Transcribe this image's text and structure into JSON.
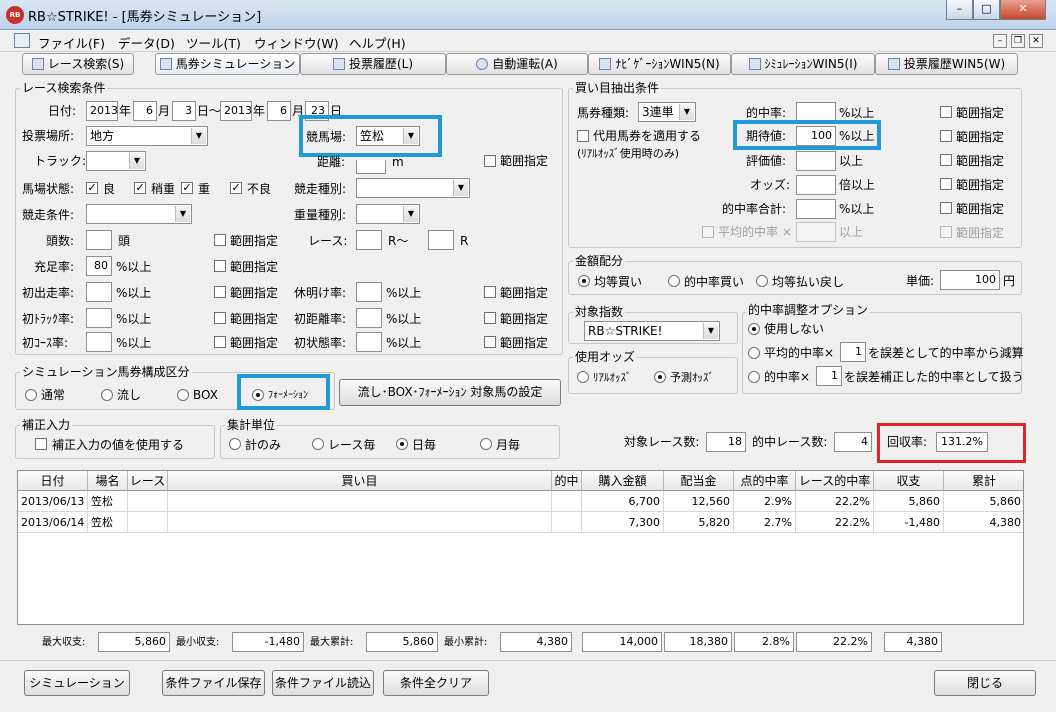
{
  "window": {
    "title": "RB☆STRIKE! - [馬券シミュレーション]",
    "icon": "app-logo-icon",
    "buttons": [
      "–",
      "□",
      "✕"
    ]
  },
  "menubar": {
    "items": [
      "ファイル(F)",
      "データ(D)",
      "ツール(T)",
      "ウィンドウ(W)",
      "ヘルプ(H)"
    ],
    "mdi": [
      "–",
      "❐",
      "✕"
    ]
  },
  "tabs": [
    {
      "label": "レース検索(S)",
      "icon": "search-icon"
    },
    {
      "label": "馬券シミュレーション(B)",
      "icon": "simulation-icon"
    },
    {
      "label": "投票履歴(L)",
      "icon": "history-icon"
    },
    {
      "label": "自動運転(A)",
      "icon": "clock-icon"
    },
    {
      "label": "ﾅﾋﾞｹﾞｰｼｮﾝWIN5(N)",
      "icon": "navigation-icon"
    },
    {
      "label": "ｼﾐｭﾚｰｼｮﾝWIN5(I)",
      "icon": "simulation-win5-icon"
    },
    {
      "label": "投票履歴WIN5(W)",
      "icon": "history-win5-icon"
    }
  ],
  "search": {
    "group_title": "レース検索条件",
    "date_label": "日付:",
    "from_year": "2013",
    "year_unit": "年",
    "from_month": "6",
    "month_unit": "月",
    "from_day": "3",
    "day_unit": "日〜",
    "to_year": "2013",
    "to_month": "6",
    "to_day": "23",
    "day_unit2": "日",
    "venue_label": "投票場所:",
    "venue_value": "地方",
    "track_name_label": "競馬場:",
    "track_name_value": "笠松",
    "track_label": "トラック:",
    "track_value": "",
    "distance_label": "距離:",
    "distance_value": "",
    "distance_unit": "m",
    "distance_range": "範囲指定",
    "condition_label": "馬場状態:",
    "conditions": [
      "良",
      "稍重",
      "重",
      "不良"
    ],
    "race_type_label": "競走種別:",
    "race_type_value": "",
    "race_cond_label": "競走条件:",
    "race_cond_value": "",
    "weight_label": "重量種別:",
    "weight_value": "",
    "head_label": "頭数:",
    "head_value": "",
    "head_unit": "頭",
    "head_range": "範囲指定",
    "race_label": "レース:",
    "race_from": "",
    "race_from_unit": "R〜",
    "race_to": "",
    "race_to_unit": "R",
    "fill_label": "充足率:",
    "fill_value": "80",
    "fill_unit": "%以上",
    "fill_range": "範囲指定",
    "debut_label": "初出走率:",
    "debut_unit": "%以上",
    "debut_range": "範囲指定",
    "rest_label": "休明け率:",
    "rest_unit": "%以上",
    "rest_range": "範囲指定",
    "firsttrack_label": "初ﾄﾗｯｸ率:",
    "firsttrack_unit": "%以上",
    "firsttrack_range": "範囲指定",
    "firstdist_label": "初距離率:",
    "firstdist_unit": "%以上",
    "firstdist_range": "範囲指定",
    "firstcourse_label": "初ｺｰｽ率:",
    "firstcourse_unit": "%以上",
    "firstcourse_range": "範囲指定",
    "firststate_label": "初状態率:",
    "firststate_unit": "%以上",
    "firststate_range": "範囲指定"
  },
  "sim_comp": {
    "group_title": "シミュレーション馬券構成区分",
    "options": [
      "通常",
      "流し",
      "BOX",
      "ﾌｫｰﾒｰｼｮﾝ"
    ],
    "selected": 3,
    "set_button": "流し･BOX･ﾌｫｰﾒｰｼｮﾝ 対象馬の設定"
  },
  "correction": {
    "group_title": "補正入力",
    "checkbox": "補正入力の値を使用する"
  },
  "aggregate": {
    "group_title": "集計単位",
    "options": [
      "計のみ",
      "レース毎",
      "日毎",
      "月毎"
    ],
    "selected": 2
  },
  "extract": {
    "group_title": "買い目抽出条件",
    "ticket_label": "馬券種類:",
    "ticket_value": "3連単",
    "substitute_label": "代用馬券を適用する",
    "substitute_note": "(ﾘｱﾙｵｯｽﾞ使用時のみ)",
    "hit_label": "的中率:",
    "hit_value": "",
    "hit_unit": "%以上",
    "ev_label": "期待値:",
    "ev_value": "100",
    "ev_unit": "%以上",
    "eval_label": "評価値:",
    "eval_value": "",
    "eval_unit": "以上",
    "odds_label": "オッズ:",
    "odds_value": "",
    "odds_unit": "倍以上",
    "hitsum_label": "的中率合計:",
    "hitsum_value": "",
    "hitsum_unit": "%以上",
    "avg_label": "平均的中率 ×",
    "avg_value": "",
    "avg_unit": "以上",
    "range": "範囲指定"
  },
  "allocation": {
    "group_title": "金額配分",
    "options": [
      "均等買い",
      "的中率買い",
      "均等払い戻し"
    ],
    "selected": 0,
    "unit_label": "単価:",
    "unit_value": "100",
    "unit_suffix": "円"
  },
  "index": {
    "group_title": "対象指数",
    "value": "RB☆STRIKE!"
  },
  "odds_used": {
    "group_title": "使用オッズ",
    "options": [
      "ﾘｱﾙｵｯｽﾞ",
      "予測ｵｯｽﾞ"
    ],
    "selected": 1
  },
  "hit_adjust": {
    "group_title": "的中率調整オプション",
    "opt0": "使用しない",
    "opt1_pre": "平均的中率×",
    "opt1_val": "1",
    "opt1_post": "を誤差として的中率から減算",
    "opt2_pre": "的中率×",
    "opt2_val": "1",
    "opt2_post": "を誤差補正した的中率として扱う",
    "selected": 0
  },
  "summary": {
    "target_label": "対象レース数:",
    "target_value": "18",
    "hit_label": "的中レース数:",
    "hit_value": "4",
    "recovery_label": "回収率:",
    "recovery_value": "131.2%"
  },
  "table": {
    "headers": [
      "日付",
      "場名",
      "レース",
      "買い目",
      "的中",
      "購入金額",
      "配当金",
      "点的中率",
      "レース的中率",
      "収支",
      "累計"
    ],
    "rows": [
      [
        "2013/06/13",
        "笠松",
        "",
        "",
        "",
        "6,700",
        "12,560",
        "2.9%",
        "22.2%",
        "5,860",
        "5,860"
      ],
      [
        "2013/06/14",
        "笠松",
        "",
        "",
        "",
        "7,300",
        "5,820",
        "2.7%",
        "22.2%",
        "-1,480",
        "4,380"
      ]
    ]
  },
  "totals": {
    "max_income_label": "最大収支:",
    "max_income": "5,860",
    "min_income_label": "最小収支:",
    "min_income": "-1,480",
    "max_cum_label": "最大累計:",
    "max_cum": "5,860",
    "min_cum_label": "最小累計:",
    "min_cum": "4,380",
    "purchase": "14,000",
    "payout": "18,380",
    "point_hit": "2.8%",
    "race_hit": "22.2%",
    "balance": "4,380"
  },
  "footer": {
    "simulate": "シミュレーション",
    "save": "条件ファイル保存",
    "load": "条件ファイル読込",
    "clear": "条件全クリア",
    "close": "閉じる"
  },
  "colors": {
    "highlight_blue": "#1e9ad6",
    "highlight_red": "#e0242a"
  }
}
